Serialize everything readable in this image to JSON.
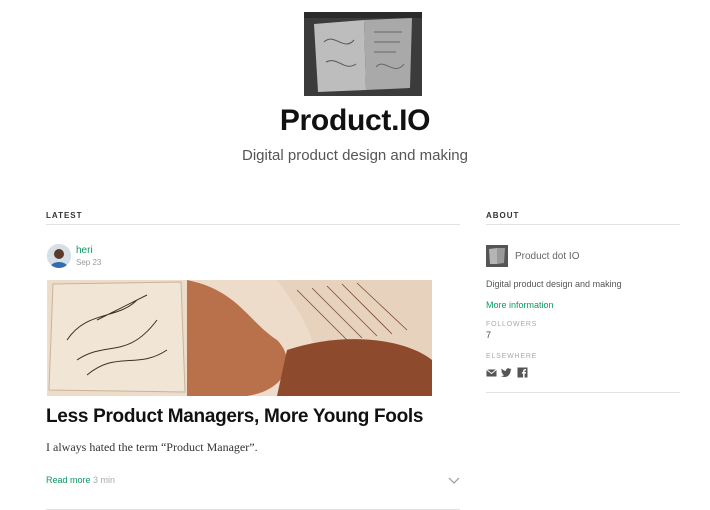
{
  "header": {
    "title": "Product.IO",
    "tagline": "Digital product design and making"
  },
  "latest": {
    "section_label": "LATEST",
    "post": {
      "author": "heri",
      "date": "Sep 23",
      "title": "Less Product Managers, More Young Fools",
      "excerpt": "I always hated the term “Product Manager”.",
      "read_more_label": "Read more",
      "read_time": "3 min"
    }
  },
  "about": {
    "section_label": "ABOUT",
    "name": "Product dot IO",
    "description": "Digital product design and making",
    "more_info_label": "More information",
    "followers_label": "FOLLOWERS",
    "followers_count": "7",
    "elsewhere_label": "ELSEWHERE",
    "social_icons": [
      "email-icon",
      "twitter-icon",
      "facebook-icon"
    ]
  },
  "colors": {
    "accent": "#0a9b61",
    "title": "#111111",
    "muted": "#999999"
  }
}
